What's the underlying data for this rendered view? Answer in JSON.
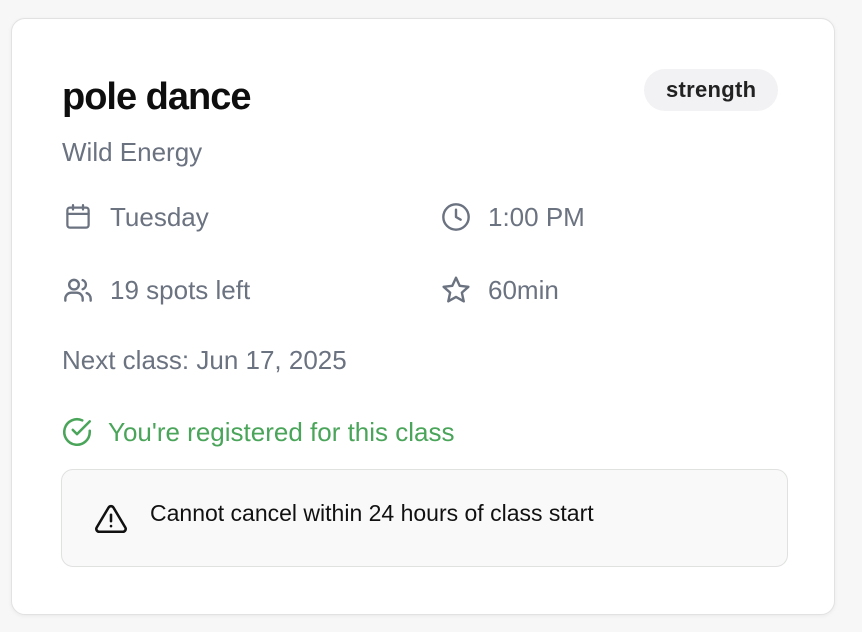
{
  "class": {
    "title": "pole dance",
    "category": "strength",
    "studio": "Wild Energy",
    "day": "Tuesday",
    "time": "1:00 PM",
    "spots": "19 spots left",
    "duration": "60min",
    "next_class": "Next class: Jun 17, 2025"
  },
  "status": {
    "registered_text": "You're registered for this class",
    "cancel_notice": "Cannot cancel within 24 hours of class start"
  },
  "icons": {
    "day": "calendar-icon",
    "time": "clock-icon",
    "spots": "users-icon",
    "duration": "star-icon",
    "registered": "check-circle-icon",
    "notice": "warning-triangle-icon"
  },
  "colors": {
    "muted_text": "#6b7280",
    "success": "#4aa55a",
    "badge_bg": "#f2f2f4"
  }
}
